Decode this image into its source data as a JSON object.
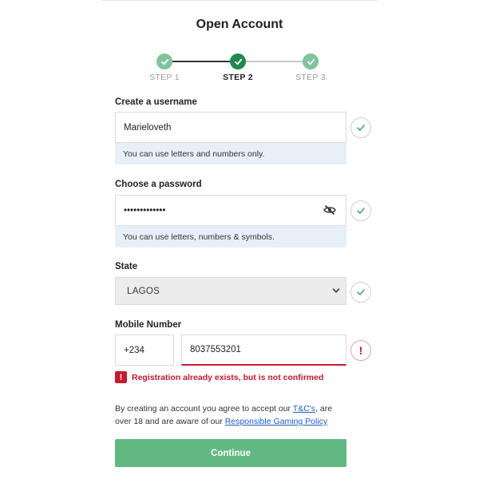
{
  "title": "Open Account",
  "stepper": {
    "steps": [
      {
        "label": "STEP 1",
        "state": "done"
      },
      {
        "label": "STEP 2",
        "state": "current"
      },
      {
        "label": "STEP 3",
        "state": "done"
      }
    ]
  },
  "username": {
    "label": "Create a username",
    "value": "Marieloveth",
    "hint": "You can use letters and numbers only.",
    "status_icon": "check-icon"
  },
  "password": {
    "label": "Choose a password",
    "value": "•••••••••••••",
    "hint": "You can use letters, numbers & symbols.",
    "visibility_icon": "eye-slash-icon",
    "status_icon": "check-icon"
  },
  "state": {
    "label": "State",
    "selected": "LAGOS",
    "status_icon": "check-icon"
  },
  "mobile": {
    "label": "Mobile Number",
    "prefix": "+234",
    "value": "8037553201",
    "status_icon": "exclamation-icon",
    "error_badge": "!",
    "error_message": "Registration already exists, but is not confirmed"
  },
  "terms": {
    "text_1": "By creating an account you agree to accept our ",
    "link_tc": "T&C's",
    "text_2": ", are over 18 and are aware of our ",
    "link_policy": "Responsible Gaming Policy"
  },
  "continue_label": "Continue",
  "colors": {
    "accent_green": "#62b883",
    "dark_green": "#1e8a4d",
    "error_red": "#c8192e",
    "hint_bg": "#e7f0f8"
  }
}
